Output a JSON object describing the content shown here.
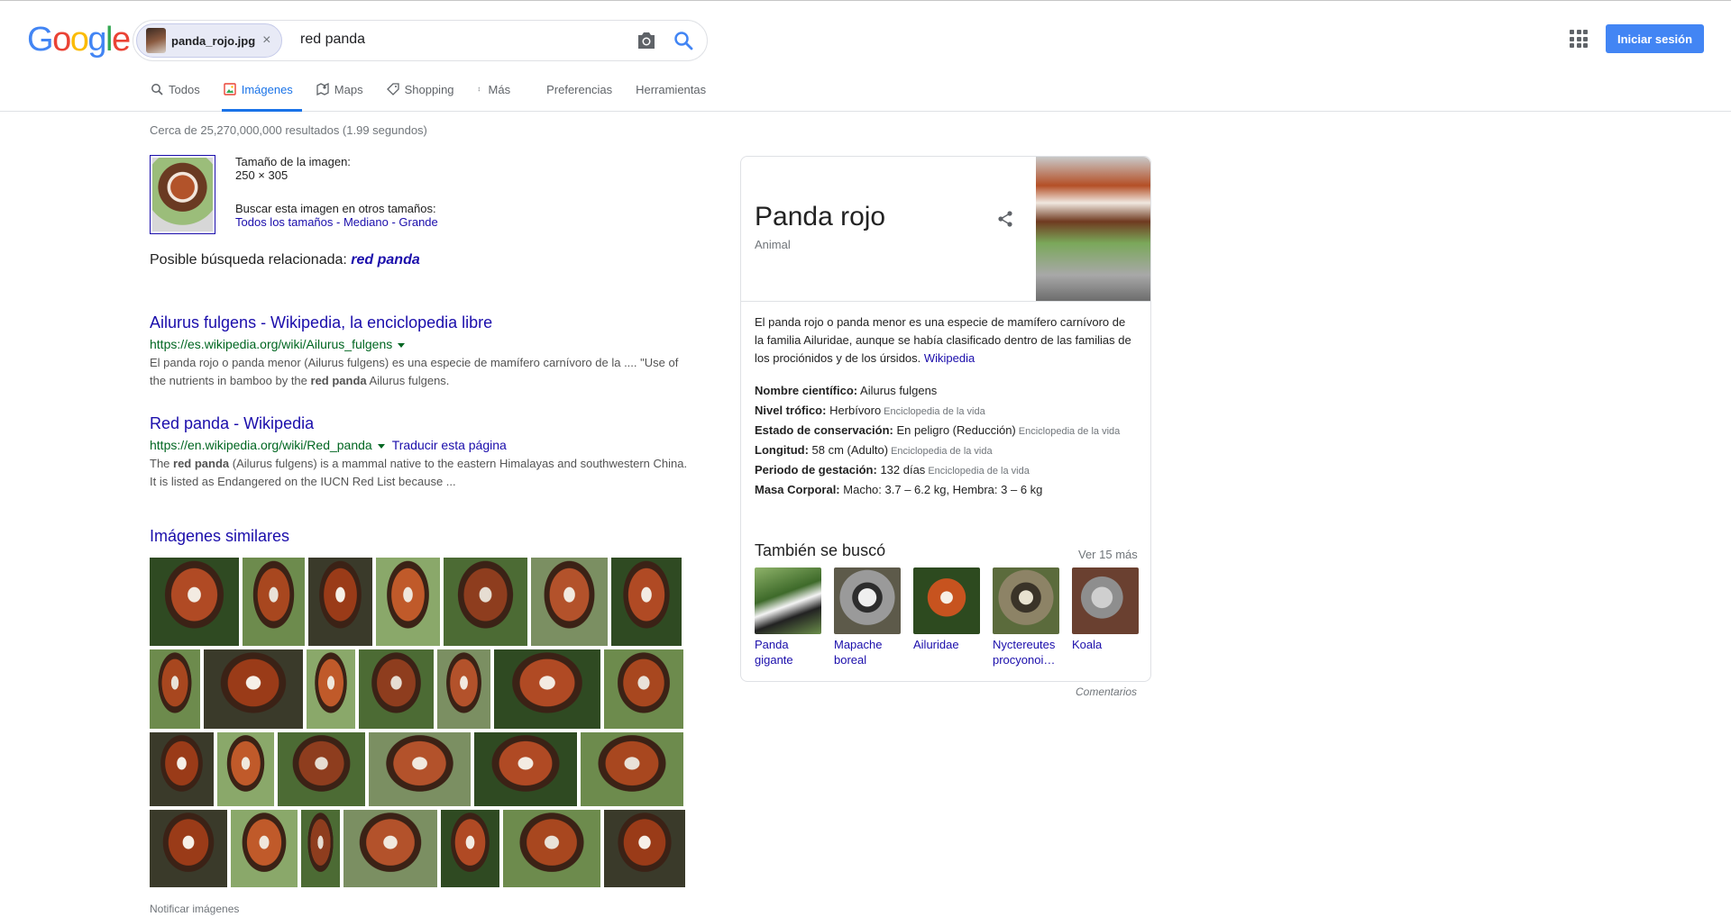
{
  "brand": {
    "logo_letters": [
      "G",
      "o",
      "o",
      "g",
      "l",
      "e"
    ],
    "logo_colors": [
      "#4285f4",
      "#ea4335",
      "#fbbc05",
      "#4285f4",
      "#34a853",
      "#ea4335"
    ]
  },
  "search": {
    "chip_label": "panda_rojo.jpg",
    "chip_close": "×",
    "query": "red panda"
  },
  "header": {
    "signin_label": "Iniciar sesión"
  },
  "tabs": [
    {
      "label": "Todos",
      "icon": "search-icon"
    },
    {
      "label": "Imágenes",
      "icon": "image-icon",
      "active": true
    },
    {
      "label": "Maps",
      "icon": "map-icon"
    },
    {
      "label": "Shopping",
      "icon": "tag-icon"
    },
    {
      "label": "Más",
      "icon": "more-vert-icon"
    },
    {
      "label": "Preferencias"
    },
    {
      "label": "Herramientas"
    }
  ],
  "results": {
    "stats": "Cerca de 25,270,000,000 resultados (1.99 segundos)",
    "image_info": {
      "size_label": "Tamaño de la imagen:",
      "size_value": "250 × 305",
      "other_sizes_label": "Buscar esta imagen en otros tamaños:",
      "links": [
        "Todos los tamaños",
        "Mediano",
        "Grande"
      ],
      "sep": " - "
    },
    "related_prefix": "Posible búsqueda relacionada:",
    "related_query": "red panda",
    "items": [
      {
        "title": "Ailurus fulgens - Wikipedia, la enciclopedia libre",
        "url": "https://es.wikipedia.org/wiki/Ailurus_fulgens",
        "translate": "",
        "snippet_1": "El panda rojo o panda menor (Ailurus fulgens) es una especie de mamífero carnívoro de la .... \"Use of",
        "snippet_2_pre": "the nutrients in bamboo by the ",
        "snippet_2_bold": "red panda",
        "snippet_2_post": " Ailurus fulgens."
      },
      {
        "title": "Red panda - Wikipedia",
        "url": "https://en.wikipedia.org/wiki/Red_panda",
        "translate": "Traducir esta página",
        "snippet_1_pre": "The ",
        "snippet_1_bold": "red panda",
        "snippet_1_post": " (Ailurus fulgens) is a mammal native to the eastern Himalayas and southwestern China.",
        "snippet_2": "It is listed as Endangered on the IUCN Red List because ..."
      }
    ],
    "similar_title": "Imágenes similares",
    "notify_label": "Notificar imágenes"
  },
  "knowledge_panel": {
    "title": "Panda rojo",
    "subtitle": "Animal",
    "description": "El panda rojo o panda menor es una especie de mamífero carnívoro de la familia Ailuridae, aunque se había clasificado dentro de las familias de los prociónidos y de los úrsidos.",
    "description_link": "Wikipedia",
    "facts": [
      {
        "label": "Nombre científico:",
        "value": "Ailurus fulgens",
        "source": ""
      },
      {
        "label": "Nivel trófico:",
        "value": "Herbívoro",
        "source": "Enciclopedia de la vida"
      },
      {
        "label": "Estado de conservación:",
        "value": "En peligro (Reducción)",
        "source": "Enciclopedia de la vida"
      },
      {
        "label": "Longitud:",
        "value": "58 cm (Adulto)",
        "source": "Enciclopedia de la vida"
      },
      {
        "label": "Periodo de gestación:",
        "value": "132 días",
        "source": "Enciclopedia de la vida"
      },
      {
        "label": "Masa Corporal:",
        "value": "Macho: 3.7 – 6.2 kg, Hembra: 3 – 6 kg",
        "source": ""
      }
    ],
    "also_searched_title": "También se buscó",
    "also_searched_more": "Ver 15 más",
    "also_searched": [
      {
        "line1": "Panda",
        "line2": "gigante"
      },
      {
        "line1": "Mapache",
        "line2": "boreal"
      },
      {
        "line1": "Ailuridae",
        "line2": ""
      },
      {
        "line1": "Nyctereutes",
        "line2": "procyonoi…"
      },
      {
        "line1": "Koala",
        "line2": ""
      }
    ],
    "feedback": "Comentarios"
  },
  "colors": {
    "accent": "#1a73e8",
    "link": "#1a0dab",
    "url_green": "#006621",
    "signin_blue": "#4285f4"
  }
}
